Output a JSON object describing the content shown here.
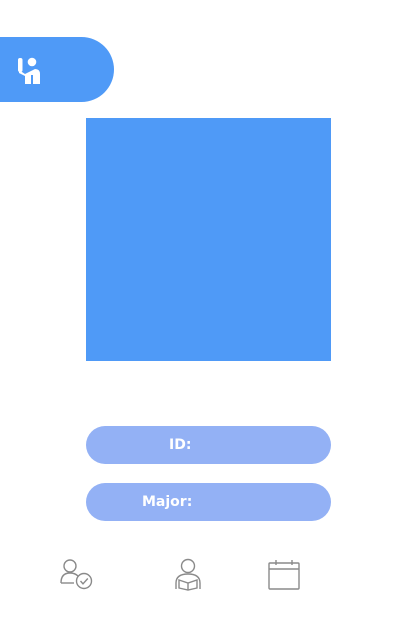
{
  "header": {
    "tab_icon": "raise-hand-icon",
    "accent_color": "#4f9af7"
  },
  "profile": {
    "photo_color": "#4f9af7",
    "id_label": "ID:",
    "id_value": "",
    "major_label": "Major:",
    "major_value": "",
    "pill_color": "#93b1f5"
  },
  "bottom_nav": {
    "items": [
      {
        "icon": "user-check-icon"
      },
      {
        "icon": "user-reading-icon"
      },
      {
        "icon": "calendar-icon"
      }
    ],
    "icon_color": "#8a8a8a"
  }
}
